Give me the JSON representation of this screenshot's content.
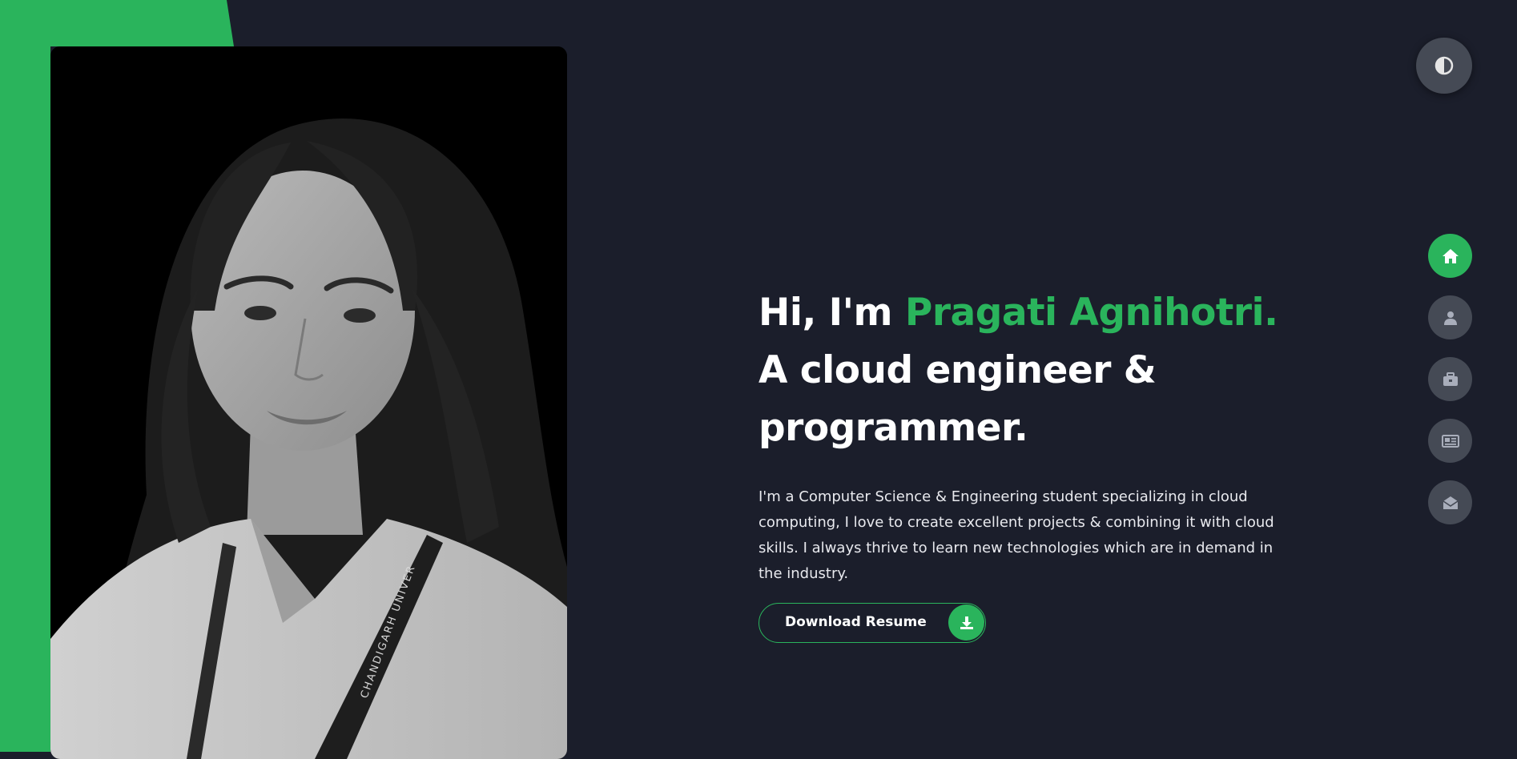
{
  "theme": {
    "background": "#1b1e2b",
    "accent": "#2ab45c",
    "nav_button": "#454a55",
    "text": "#ffffff"
  },
  "hero": {
    "greeting": "Hi, I'm",
    "name": "Pragati Agnihotri.",
    "role_line_1": "A cloud engineer &",
    "role_line_2": "programmer.",
    "bio": "I'm a Computer Science & Engineering student specializing in cloud computing, I love to create excellent projects & combining it with cloud skills. I always thrive to learn new technologies which are in demand in the industry.",
    "download_label": "Download Resume",
    "download_icon": "download-icon"
  },
  "portrait": {
    "badge_text": "CHANDIGARH UNIVER"
  },
  "theme_toggle": {
    "icon": "contrast-icon"
  },
  "nav": {
    "items": [
      {
        "icon": "home-icon",
        "active": true
      },
      {
        "icon": "user-icon",
        "active": false
      },
      {
        "icon": "briefcase-icon",
        "active": false
      },
      {
        "icon": "newspaper-icon",
        "active": false
      },
      {
        "icon": "envelope-open-icon",
        "active": false
      }
    ]
  }
}
